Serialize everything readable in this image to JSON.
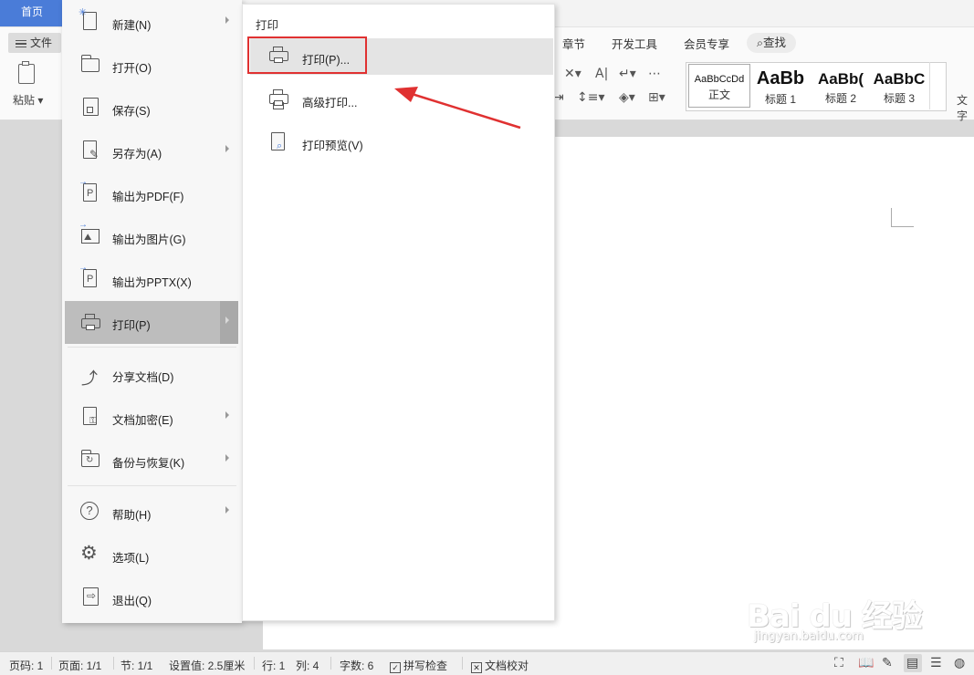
{
  "topbar": {
    "home_tab": "首页"
  },
  "ribbon": {
    "file_button": "文件",
    "paste_label": "粘贴",
    "tabs": [
      "章节",
      "开发工具",
      "会员专享"
    ],
    "search_tab": "查找",
    "styles": [
      {
        "sample": "AaBbCcDd",
        "name": "正文"
      },
      {
        "sample": "AaBb",
        "name": "标题 1"
      },
      {
        "sample": "AaBb(",
        "name": "标题 2"
      },
      {
        "sample": "AaBbC",
        "name": "标题 3"
      }
    ],
    "text_tool_label": "文字"
  },
  "file_menu": {
    "items": [
      {
        "label": "新建(N)",
        "icon": "new-file-icon",
        "submenu": true
      },
      {
        "label": "打开(O)",
        "icon": "folder-icon",
        "submenu": false
      },
      {
        "label": "保存(S)",
        "icon": "save-icon",
        "submenu": false
      },
      {
        "label": "另存为(A)",
        "icon": "save-as-icon",
        "submenu": true
      },
      {
        "label": "输出为PDF(F)",
        "icon": "export-pdf-icon",
        "submenu": false
      },
      {
        "label": "输出为图片(G)",
        "icon": "export-image-icon",
        "submenu": false
      },
      {
        "label": "输出为PPTX(X)",
        "icon": "export-pptx-icon",
        "submenu": false
      },
      {
        "label": "打印(P)",
        "icon": "printer-icon",
        "submenu": true,
        "active": true
      },
      {
        "label": "分享文档(D)",
        "icon": "share-icon",
        "submenu": false
      },
      {
        "label": "文档加密(E)",
        "icon": "encrypt-icon",
        "submenu": true
      },
      {
        "label": "备份与恢复(K)",
        "icon": "backup-icon",
        "submenu": true
      },
      {
        "label": "帮助(H)",
        "icon": "help-icon",
        "submenu": true
      },
      {
        "label": "选项(L)",
        "icon": "settings-gear-icon",
        "submenu": false
      },
      {
        "label": "退出(Q)",
        "icon": "exit-icon",
        "submenu": false
      }
    ]
  },
  "print_submenu": {
    "title": "打印",
    "items": [
      {
        "label": "打印(P)...",
        "icon": "printer-icon",
        "highlighted": true
      },
      {
        "label": "高级打印...",
        "icon": "advanced-print-icon"
      },
      {
        "label": "打印预览(V)",
        "icon": "print-preview-icon"
      }
    ]
  },
  "statusbar": {
    "page_no": "页码: 1",
    "pages": "页面: 1/1",
    "section": "节: 1/1",
    "setting": "设置值: 2.5厘米",
    "row": "行: 1",
    "col": "列: 4",
    "word_count": "字数: 6",
    "spell_check": "拼写检查",
    "doc_proof": "文档校对"
  },
  "watermark": {
    "logo": "Bai du 经验",
    "url": "jingyan.baidu.com"
  },
  "colors": {
    "accent_blue": "#4a7cd8",
    "highlight_red": "#e03131",
    "menu_active": "#bdbdbd"
  }
}
